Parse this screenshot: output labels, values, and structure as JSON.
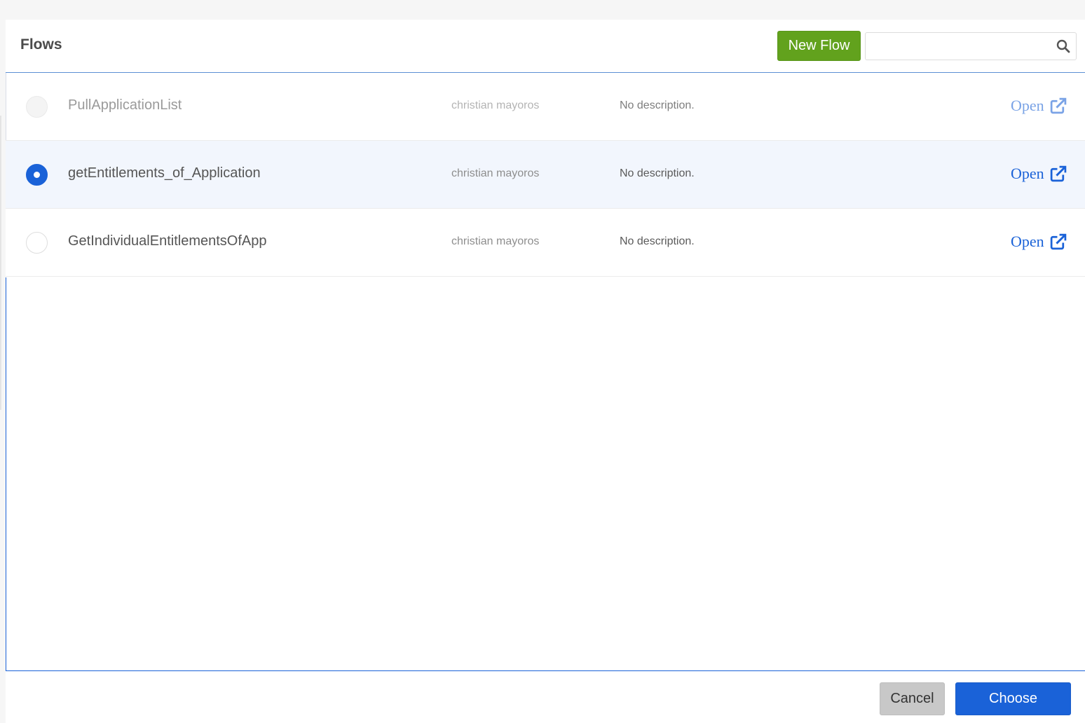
{
  "modal": {
    "title": "Flows",
    "new_flow_label": "New Flow",
    "search": {
      "value": "",
      "placeholder": ""
    }
  },
  "flows": [
    {
      "name": "PullApplicationList",
      "owner": "christian mayoros",
      "description": "No description.",
      "open_label": "Open",
      "state": "disabled"
    },
    {
      "name": "getEntitlements_of_Application",
      "owner": "christian mayoros",
      "description": "No description.",
      "open_label": "Open",
      "state": "selected"
    },
    {
      "name": "GetIndividualEntitlementsOfApp",
      "owner": "christian mayoros",
      "description": "No description.",
      "open_label": "Open",
      "state": "default"
    }
  ],
  "footer": {
    "cancel_label": "Cancel",
    "choose_label": "Choose"
  },
  "icons": {
    "search": "search-icon",
    "open": "external-link-icon"
  },
  "colors": {
    "primary": "#1a62d8",
    "new_flow": "#62a21d",
    "cancel": "#c8c8c8",
    "selected_row": "#f2f6fd"
  }
}
